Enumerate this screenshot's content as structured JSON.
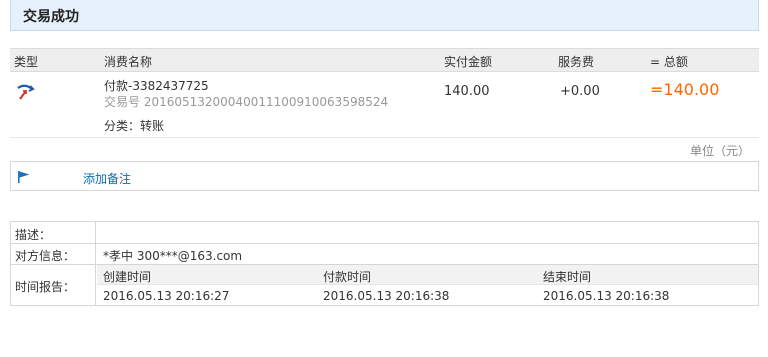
{
  "banner": {
    "title": "交易成功"
  },
  "table": {
    "headers": {
      "type": "类型",
      "name": "消费名称",
      "paid": "实付金额",
      "fee": "服务费",
      "total": "= 总额"
    },
    "row": {
      "icon": "transfer-icon",
      "name": "付款-3382437725",
      "trade_no": "交易号 2016051320004001110091006359852​4",
      "paid": "140.00",
      "fee": "+0.00",
      "total": "=140.00",
      "category": "分类：转账"
    }
  },
  "unit_note": "单位（元）",
  "memo": {
    "icon": "flag-icon",
    "link": "添加备注"
  },
  "detail": {
    "desc_label": "描述：",
    "desc_value": "",
    "party_label": "对方信息：",
    "party_value": "*孝中 300***@163.com",
    "time_label": "时间报告：",
    "time_headers": [
      "创建时间",
      "付款时间",
      "结束时间"
    ],
    "time_values": [
      "2016.05.13 20:16:27",
      "2016.05.13 20:16:38",
      "2016.05.13 20:16:38"
    ]
  },
  "colors": {
    "accent_orange": "#ff6600",
    "link_blue": "#0b6fb3",
    "banner_bg": "#e6f1fb"
  }
}
